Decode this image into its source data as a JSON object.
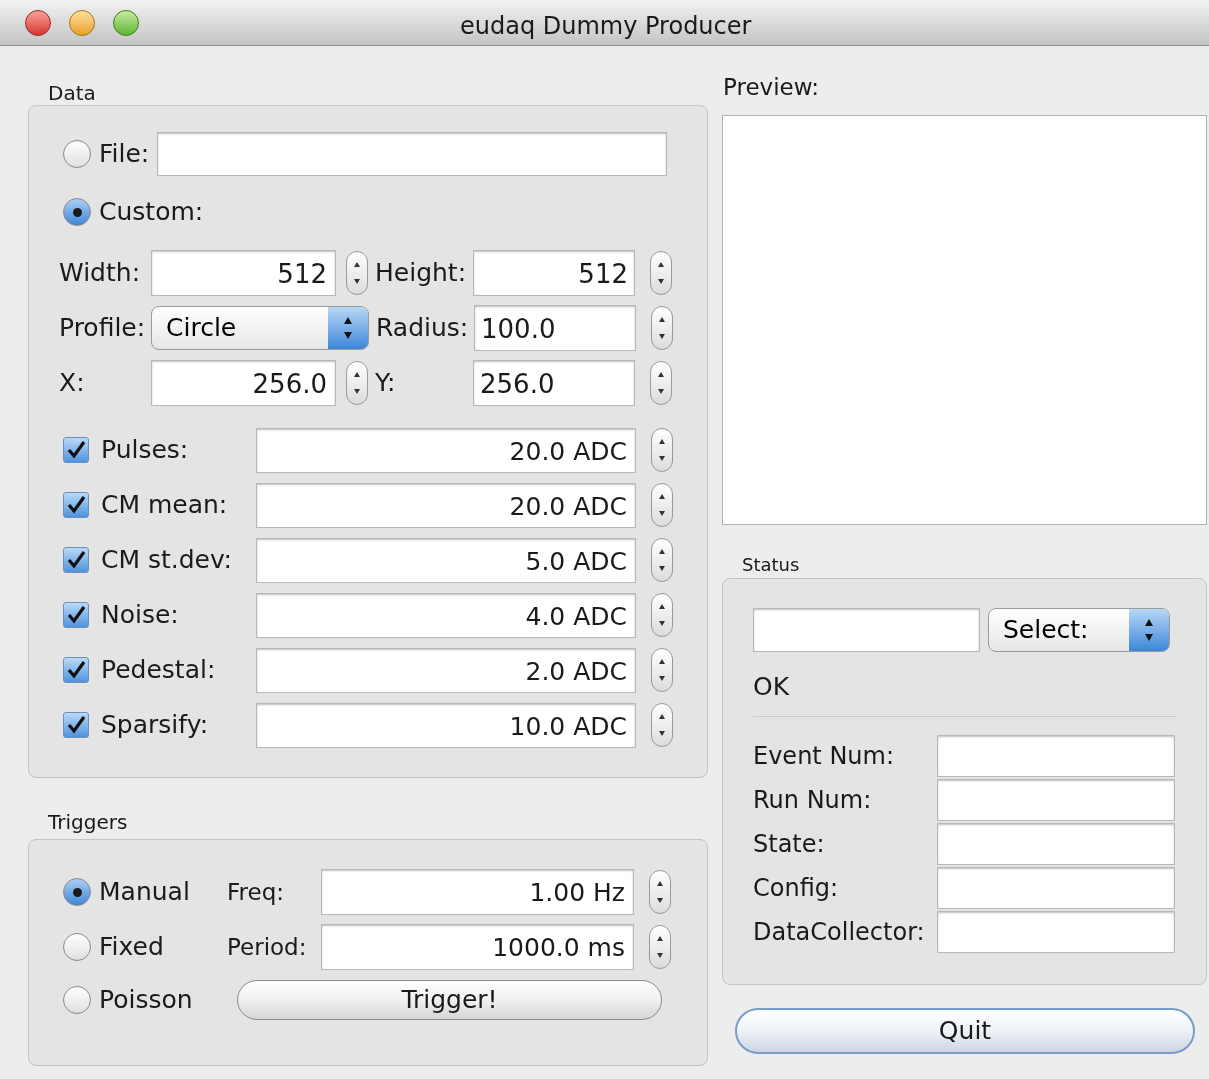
{
  "window": {
    "title": "eudaq Dummy Producer"
  },
  "data": {
    "title": "Data",
    "source": [
      {
        "label": "File:",
        "selected": false,
        "kind": "file"
      },
      {
        "label": "Custom:",
        "selected": true,
        "kind": "plain"
      }
    ],
    "grid": [
      {
        "label": "Width:",
        "value": "512",
        "label2": "Height:",
        "value2": "512",
        "kind": "spin"
      },
      {
        "label": "Profile:",
        "value": "Circle",
        "label2": "Radius:",
        "value2": "100.0",
        "kind": "select"
      },
      {
        "label": "X:",
        "value": "256.0",
        "label2": "Y:",
        "value2": "256.0",
        "kind": "spin"
      }
    ],
    "params": [
      {
        "label": "Pulses:",
        "checked": true,
        "value": "20.0 ADC"
      },
      {
        "label": "CM mean:",
        "checked": true,
        "value": "20.0 ADC"
      },
      {
        "label": "CM st.dev:",
        "checked": true,
        "value": "5.0 ADC"
      },
      {
        "label": "Noise:",
        "checked": true,
        "value": "4.0 ADC"
      },
      {
        "label": "Pedestal:",
        "checked": true,
        "value": "2.0 ADC"
      },
      {
        "label": "Sparsify:",
        "checked": true,
        "value": "10.0 ADC"
      }
    ]
  },
  "triggers": {
    "title": "Triggers",
    "modes": [
      {
        "label": "Manual",
        "selected": true
      },
      {
        "label": "Fixed",
        "selected": false
      },
      {
        "label": "Poisson",
        "selected": false
      }
    ],
    "fields": [
      {
        "label": "Freq:",
        "value": "1.00 Hz"
      },
      {
        "label": "Period:",
        "value": "1000.0 ms"
      }
    ],
    "button": "Trigger!"
  },
  "preview": {
    "title": "Preview:"
  },
  "status": {
    "title": "Status",
    "select": "Select:",
    "message": "OK",
    "info": [
      {
        "label": "Event Num:"
      },
      {
        "label": "Run Num:"
      },
      {
        "label": "State:"
      },
      {
        "label": "Config:"
      },
      {
        "label": "DataCollector:"
      }
    ]
  },
  "quit": "Quit"
}
